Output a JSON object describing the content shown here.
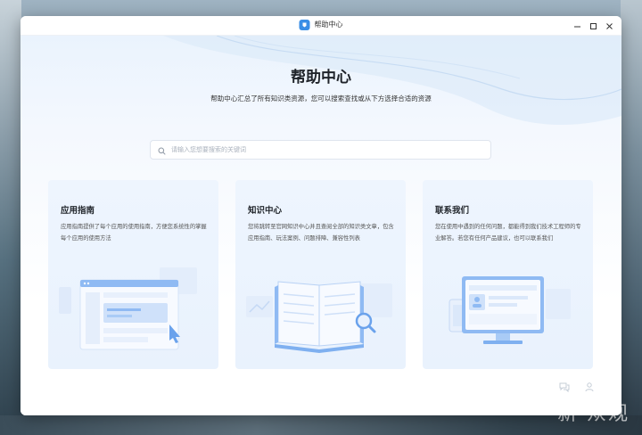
{
  "window": {
    "title": "帮助中心",
    "controls": [
      "minimize",
      "maximize",
      "close"
    ]
  },
  "hero": {
    "title": "帮助中心",
    "subtitle": "帮助中心汇总了所有知识类资源，您可以搜索查找或从下方选择合适的资源"
  },
  "search": {
    "placeholder": "请输入您想要搜索的关键词",
    "value": ""
  },
  "cards": [
    {
      "title": "应用指南",
      "description": "应用指南提供了每个应用的使用指南，方便您系统性的掌握每个应用的使用方法",
      "illustration": "app-guide-window-icon"
    },
    {
      "title": "知识中心",
      "description": "您将跳转至官网知识中心并且查阅全部的知识类文章，包含应用指南、玩法案例、问题排障、兼容性列表",
      "illustration": "open-book-icon"
    },
    {
      "title": "联系我们",
      "description": "您在使用中遇到的任何问题，都能得到我们技术工程师的专业解答。若您有任何产品建议，也可以联系我们",
      "illustration": "monitor-icon"
    }
  ],
  "footer": {
    "icons": [
      "chat-icon",
      "contact-icon"
    ]
  },
  "watermark": "新 众观",
  "colors": {
    "accent": "#3a8ee6",
    "card_bg": "#eaf2fd",
    "illustration_blue": "#7fb0f0"
  }
}
